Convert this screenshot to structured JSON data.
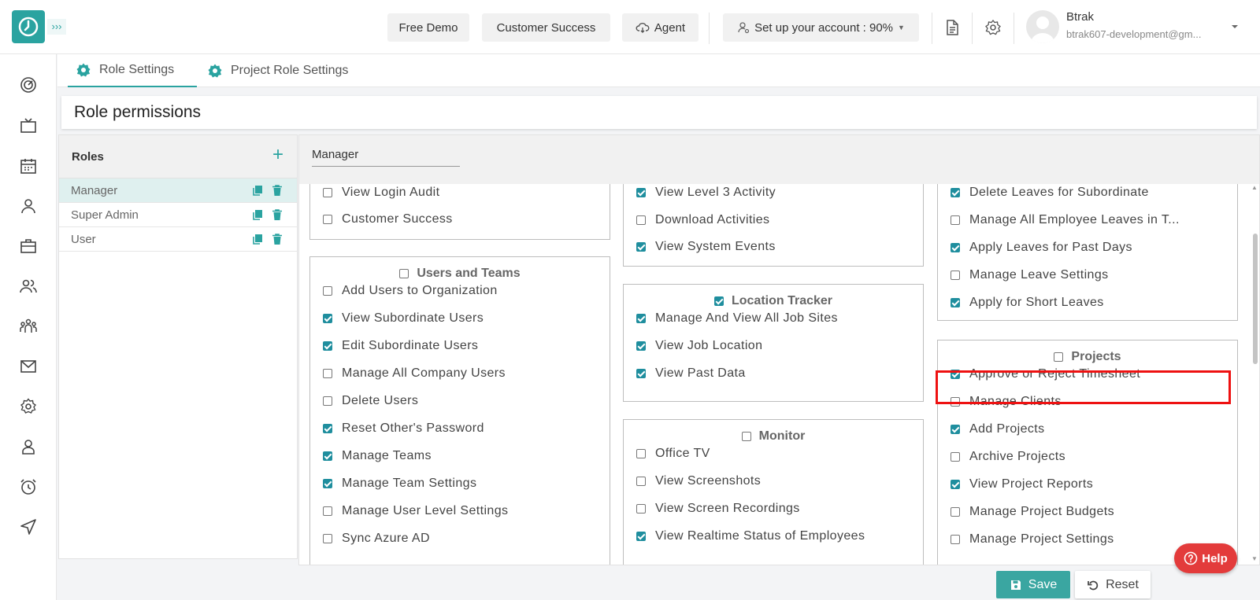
{
  "header": {
    "free_demo": "Free Demo",
    "customer_success": "Customer Success",
    "agent": "Agent",
    "setup": "Set up your account : 90%",
    "user_name": "Btrak",
    "user_email": "btrak607-development@gm..."
  },
  "tabs": [
    {
      "label": "Role Settings"
    },
    {
      "label": "Project Role Settings"
    }
  ],
  "page_title": "Role permissions",
  "roles": {
    "title": "Roles",
    "items": [
      {
        "label": "Manager"
      },
      {
        "label": "Super Admin"
      },
      {
        "label": "User"
      }
    ]
  },
  "selected_role": "Manager",
  "permissions": {
    "col1_top": {
      "items": [
        {
          "label": "View Login Audit",
          "checked": false
        },
        {
          "label": "Customer Success",
          "checked": false
        }
      ]
    },
    "users_teams": {
      "title": "Users and Teams",
      "checked": false,
      "items": [
        {
          "label": "Add Users to Organization",
          "checked": false
        },
        {
          "label": "View Subordinate Users",
          "checked": true
        },
        {
          "label": "Edit Subordinate Users",
          "checked": true
        },
        {
          "label": "Manage All Company Users",
          "checked": false
        },
        {
          "label": "Delete Users",
          "checked": false
        },
        {
          "label": "Reset Other's Password",
          "checked": true
        },
        {
          "label": "Manage Teams",
          "checked": true
        },
        {
          "label": "Manage Team Settings",
          "checked": true
        },
        {
          "label": "Manage User Level Settings",
          "checked": false
        },
        {
          "label": "Sync Azure AD",
          "checked": false
        }
      ]
    },
    "col2_top": {
      "items": [
        {
          "label": "View Level 3 Activity",
          "checked": true
        },
        {
          "label": "Download Activities",
          "checked": false
        },
        {
          "label": "View System Events",
          "checked": true
        }
      ]
    },
    "location_tracker": {
      "title": "Location Tracker",
      "checked": true,
      "items": [
        {
          "label": "Manage And View All Job Sites",
          "checked": true
        },
        {
          "label": "View Job Location",
          "checked": true
        },
        {
          "label": "View Past Data",
          "checked": true
        }
      ]
    },
    "monitor": {
      "title": "Monitor",
      "checked": false,
      "items": [
        {
          "label": "Office TV",
          "checked": false
        },
        {
          "label": "View Screenshots",
          "checked": false
        },
        {
          "label": "View Screen Recordings",
          "checked": false
        },
        {
          "label": "View Realtime Status of Employees",
          "checked": true
        }
      ]
    },
    "col3_top": {
      "items": [
        {
          "label": "Delete Leaves for Subordinate",
          "checked": true
        },
        {
          "label": "Manage All Employee Leaves in T...",
          "checked": false
        },
        {
          "label": "Apply Leaves for Past Days",
          "checked": true
        },
        {
          "label": "Manage Leave Settings",
          "checked": false
        },
        {
          "label": "Apply for Short Leaves",
          "checked": true
        }
      ]
    },
    "projects": {
      "title": "Projects",
      "checked": false,
      "items": [
        {
          "label": "Approve or Reject Timesheet",
          "checked": true
        },
        {
          "label": "Manage Clients",
          "checked": false
        },
        {
          "label": "Add Projects",
          "checked": true
        },
        {
          "label": "Archive Projects",
          "checked": false
        },
        {
          "label": "View Project Reports",
          "checked": true
        },
        {
          "label": "Manage Project Budgets",
          "checked": false
        },
        {
          "label": "Manage Project Settings",
          "checked": false
        }
      ]
    }
  },
  "buttons": {
    "help": "Help",
    "save": "Save",
    "reset": "Reset"
  },
  "colors": {
    "accent": "#2aa3a0",
    "checkbox": "#1f8e9e",
    "highlight": "#ee1111",
    "help": "#e33b3b"
  }
}
